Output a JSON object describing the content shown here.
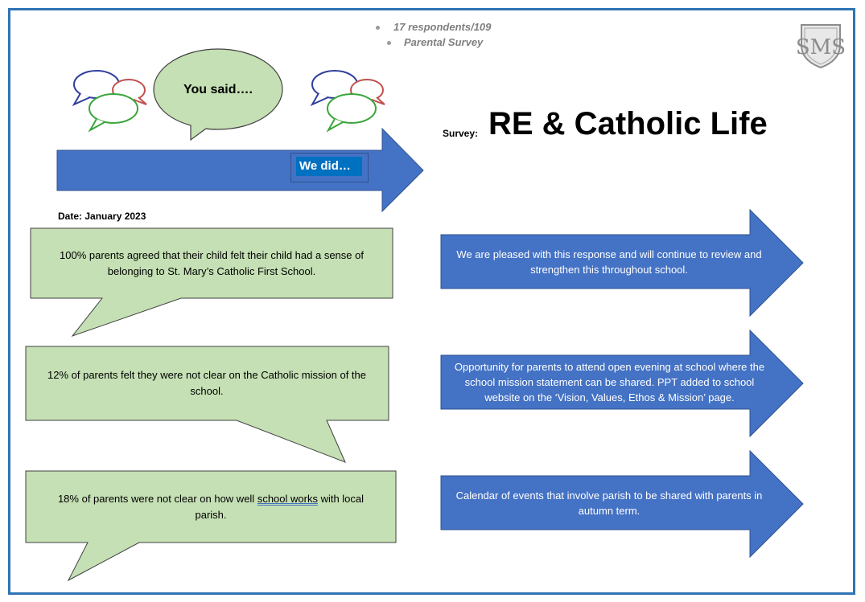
{
  "header": {
    "bullets": [
      "17 respondents/109",
      "Parental Survey"
    ],
    "you_said": "You said….",
    "we_did": "We did…",
    "survey_label": "Survey:",
    "survey_title": "RE & Catholic Life",
    "date": "Date: January 2023"
  },
  "logo": {
    "letters": "SMS"
  },
  "rows": [
    {
      "said": "100% parents agreed that their child felt their child had a sense of belonging to St. Mary’s Catholic First School.",
      "did": "We are pleased with this response and will continue to review and strengthen this throughout school."
    },
    {
      "said": "12% of parents felt they were not clear  on the Catholic mission of the school.",
      "did": "Opportunity for parents to attend open evening at school where the school mission statement can be shared. PPT added to school website on the ‘Vision, Values, Ethos & Mission’ page."
    },
    {
      "said_pre": "18% of parents were not clear on how well ",
      "said_ul": "school works",
      "said_post": " with local parish.",
      "did": "Calendar of events that involve parish to be shared with parents in autumn term."
    }
  ],
  "colors": {
    "frame": "#2f74b5",
    "arrow_blue": "#4472c4",
    "green_fill": "#c5e0b4",
    "bubble_blue": "#2f3e9e",
    "bubble_red": "#c0504d",
    "bubble_green": "#3aa53a"
  }
}
